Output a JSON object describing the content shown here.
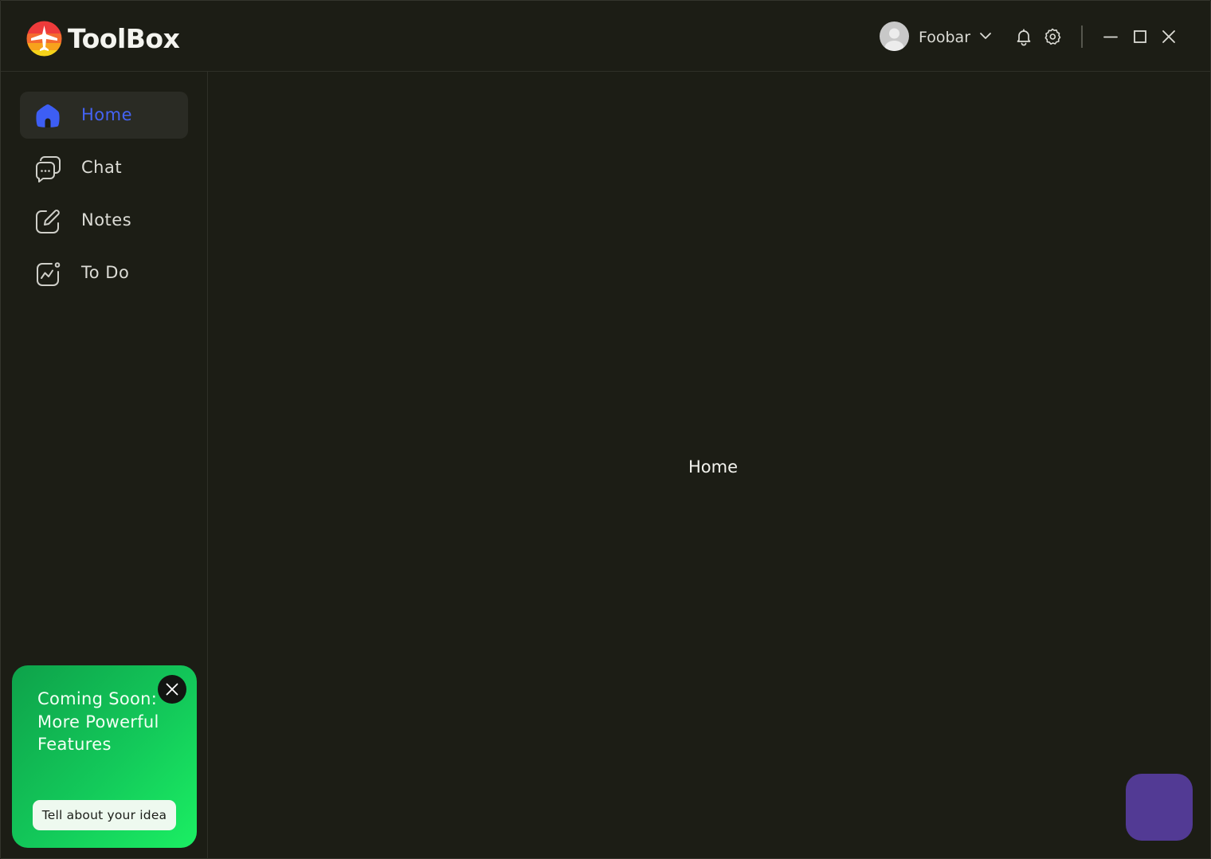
{
  "app": {
    "title": "ToolBox"
  },
  "header": {
    "user_name": "Foobar",
    "icons": [
      "user-avatar",
      "chevron-down-icon",
      "bell-icon",
      "gear-icon",
      "minimize-icon",
      "maximize-icon",
      "close-icon"
    ]
  },
  "sidebar": {
    "items": [
      {
        "label": "Home",
        "icon": "home-icon",
        "active": true
      },
      {
        "label": "Chat",
        "icon": "chat-icon",
        "active": false
      },
      {
        "label": "Notes",
        "icon": "edit-icon",
        "active": false
      },
      {
        "label": "To Do",
        "icon": "activity-icon",
        "active": false
      }
    ]
  },
  "promo": {
    "text": "Coming Soon: More Powerful Features",
    "button_label": "Tell about your idea"
  },
  "main": {
    "title": "Home"
  },
  "colors": {
    "background": "#1c1d15",
    "accent": "#4463f5",
    "promo_green": "#13c95a",
    "fab_purple": "#523a94"
  }
}
